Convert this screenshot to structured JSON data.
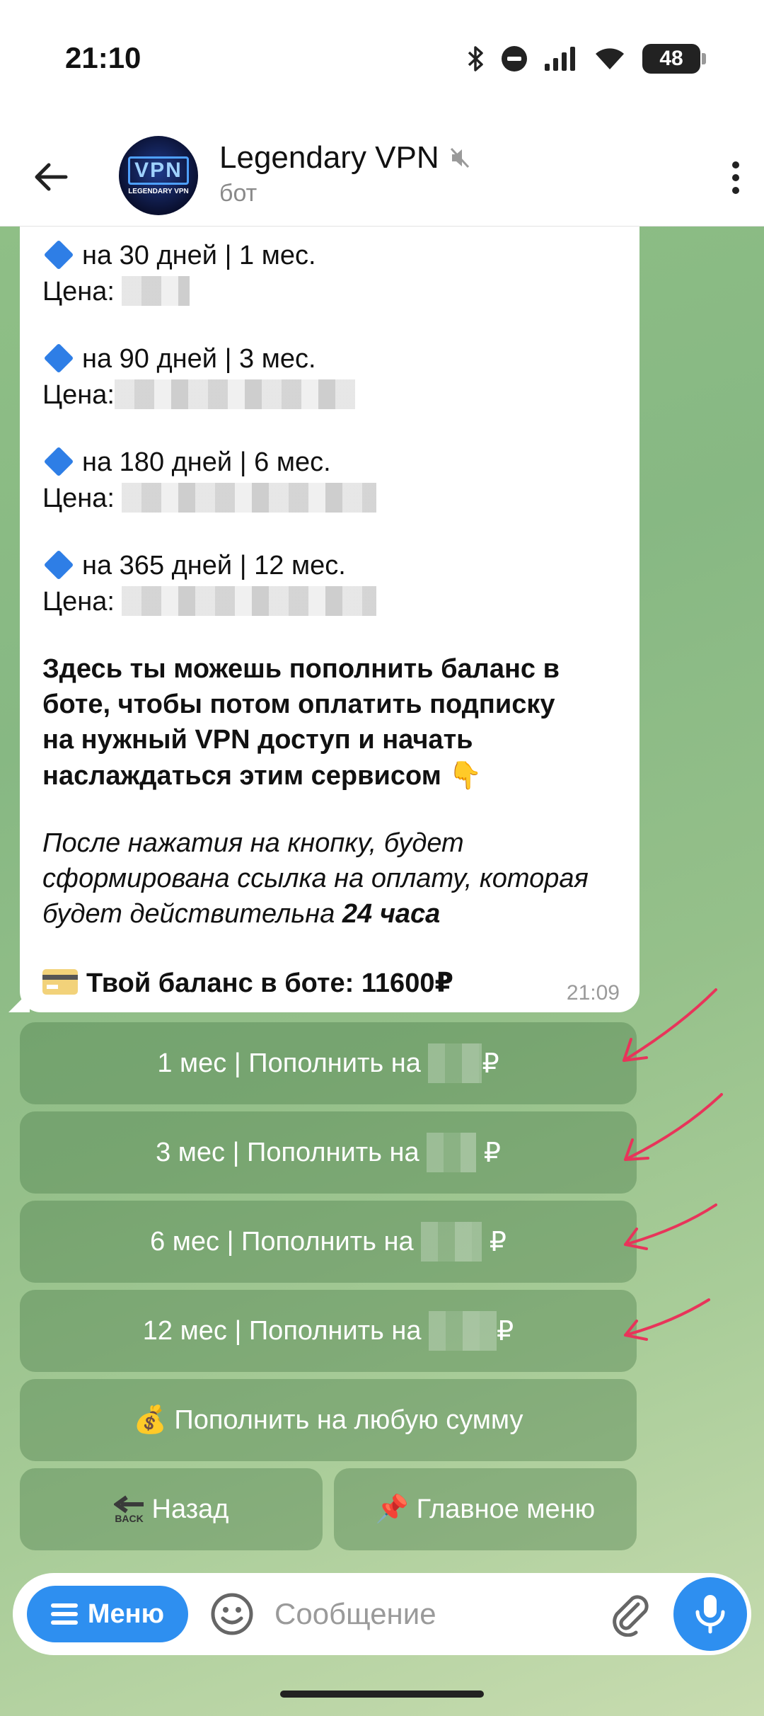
{
  "status": {
    "time": "21:10",
    "battery": "48"
  },
  "header": {
    "title": "Legendary VPN",
    "subtitle": "бот",
    "avatar_text": "VPN",
    "avatar_sub": "LEGENDARY VPN"
  },
  "message": {
    "plans": [
      {
        "title": "на 30 дней | 1 мес.",
        "price_label": "Цена:"
      },
      {
        "title": "на 90 дней | 3 мес.",
        "price_label": "Цена:"
      },
      {
        "title": "на 180 дней | 6 мес.",
        "price_label": "Цена:"
      },
      {
        "title": "на 365 дней | 12 мес.",
        "price_label": "Цена:"
      }
    ],
    "promo_lines": [
      "Здесь ты можешь пополнить баланс в",
      "боте, чтобы потом оплатить подписку",
      "на нужный VPN доступ и начать",
      "наслаждаться этим сервисом 👇"
    ],
    "note_lines": [
      "После нажатия на кнопку, будет",
      "сформирована ссылка на оплату, которая",
      "будет действительна"
    ],
    "note_bold": "24 часа",
    "balance": "Твой баланс в боте: 11600₽",
    "time": "21:09"
  },
  "keyboard": {
    "btn_1": {
      "prefix": "1 мес | Пополнить на",
      "suffix": "₽"
    },
    "btn_3": {
      "prefix": "3 мес | Пополнить на",
      "suffix": "₽"
    },
    "btn_6": {
      "prefix": "6 мес | Пополнить на",
      "suffix": "₽"
    },
    "btn_12": {
      "prefix": "12 мес | Пополнить на",
      "suffix": "₽"
    },
    "any_sum": "💰 Пополнить на любую сумму",
    "back": "Назад",
    "back_icon_text": "BACK",
    "main_menu": "📌 Главное меню"
  },
  "composer": {
    "menu_label": "Меню",
    "placeholder": "Сообщение"
  },
  "colors": {
    "accent": "#2e8ff0",
    "annotation_arrow": "#e8345a"
  }
}
